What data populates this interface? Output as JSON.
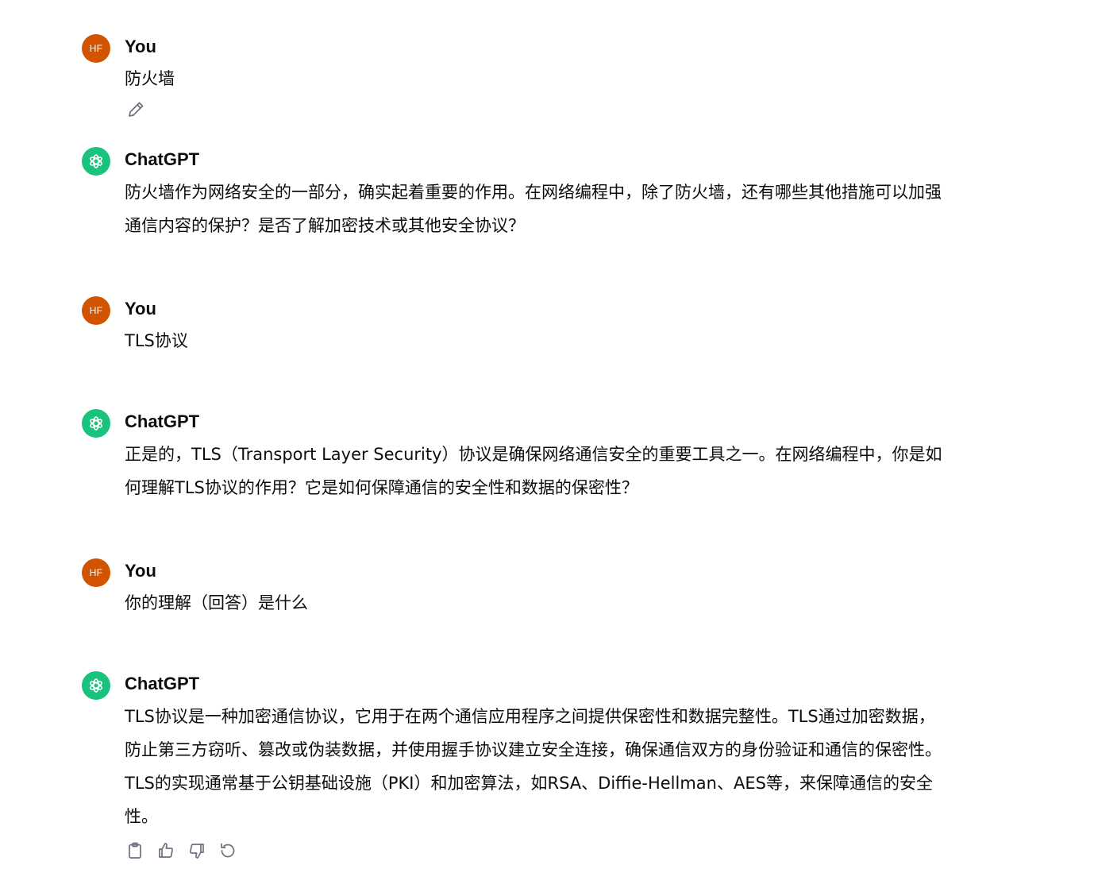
{
  "conversation": [
    {
      "role": "user",
      "avatar": "HF",
      "author": "You",
      "text": "防火墙"
    },
    {
      "role": "assistant",
      "author": "ChatGPT",
      "text": "防火墙作为网络安全的一部分，确实起着重要的作用。在网络编程中，除了防火墙，还有哪些其他措施可以加强通信内容的保护？是否了解加密技术或其他安全协议？"
    },
    {
      "role": "user",
      "avatar": "HF",
      "author": "You",
      "text": "TLS协议"
    },
    {
      "role": "assistant",
      "author": "ChatGPT",
      "text": "正是的，TLS（Transport Layer Security）协议是确保网络通信安全的重要工具之一。在网络编程中，你是如何理解TLS协议的作用？它是如何保障通信的安全性和数据的保密性？"
    },
    {
      "role": "user",
      "avatar": "HF",
      "author": "You",
      "text": "你的理解（回答）是什么"
    },
    {
      "role": "assistant",
      "author": "ChatGPT",
      "text": "TLS协议是一种加密通信协议，它用于在两个通信应用程序之间提供保密性和数据完整性。TLS通过加密数据，防止第三方窃听、篡改或伪装数据，并使用握手协议建立安全连接，确保通信双方的身份验证和通信的保密性。TLS的实现通常基于公钥基础设施（PKI）和加密算法，如RSA、Diffie-Hellman、AES等，来保障通信的安全性。"
    }
  ],
  "icons": {
    "edit": "pencil-icon",
    "copy": "clipboard-icon",
    "like": "thumbs-up-icon",
    "dislike": "thumbs-down-icon",
    "regenerate": "regenerate-icon",
    "bot_avatar": "openai-logo-icon"
  },
  "colors": {
    "user_avatar_bg": "#d35400",
    "bot_avatar_bg": "#19c37d",
    "text": "#0d0d0d",
    "icon": "#6e6e80"
  }
}
